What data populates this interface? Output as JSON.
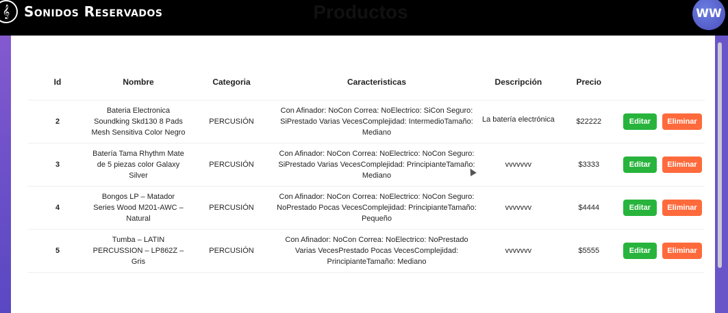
{
  "header": {
    "brand": "Sonidos Reservados",
    "logo_icon": "treble-clef-icon",
    "avatar_initials": "WW"
  },
  "page": {
    "title": "Productos"
  },
  "table": {
    "columns": [
      "Id",
      "Nombre",
      "Categoria",
      "Caracteristicas",
      "Descripción",
      "Precio"
    ],
    "rows": [
      {
        "id": "2",
        "nombre": "Bateria Electronica Soundking Skd130 8 Pads Mesh Sensitiva Color Negro",
        "categoria": "PERCUSIÓN",
        "caracteristicas": "Con Afinador: NoCon Correa: NoElectrico: SiCon Seguro: SiPrestado Varias VecesComplejidad: IntermedioTamaño: Mediano",
        "descripcion": "La batería electrónica",
        "precio": "$22222"
      },
      {
        "id": "3",
        "nombre": "Batería Tama Rhythm Mate de 5 piezas color Galaxy Silver",
        "categoria": "PERCUSIÓN",
        "caracteristicas": "Con Afinador: NoCon Correa: NoElectrico: NoCon Seguro: SiPrestado Varias VecesComplejidad: PrincipianteTamaño: Mediano",
        "descripcion": "vvvvvvv",
        "precio": "$3333"
      },
      {
        "id": "4",
        "nombre": "Bongos LP – Matador Series Wood M201-AWC – Natural",
        "categoria": "PERCUSIÓN",
        "caracteristicas": "Con Afinador: NoCon Correa: NoElectrico: NoCon Seguro: NoPrestado Pocas VecesComplejidad: PrincipianteTamaño: Pequeño",
        "descripcion": "vvvvvvv",
        "precio": "$4444"
      },
      {
        "id": "5",
        "nombre": "Tumba – LATIN PERCUSSION – LP862Z – Gris",
        "categoria": "PERCUSIÓN",
        "caracteristicas": "Con Afinador: NoCon Correa: NoElectrico: NoPrestado Varias VecesPrestado Pocas VecesComplejidad: PrincipianteTamaño: Mediano",
        "descripcion": "vvvvvvv",
        "precio": "$5555"
      }
    ],
    "actions": {
      "edit_label": "Editar",
      "delete_label": "Eliminar"
    }
  },
  "colors": {
    "edit_button": "#28b43c",
    "delete_button": "#ff6a3c",
    "header_bg": "#000000",
    "side_gradient": "#7a58cc"
  }
}
